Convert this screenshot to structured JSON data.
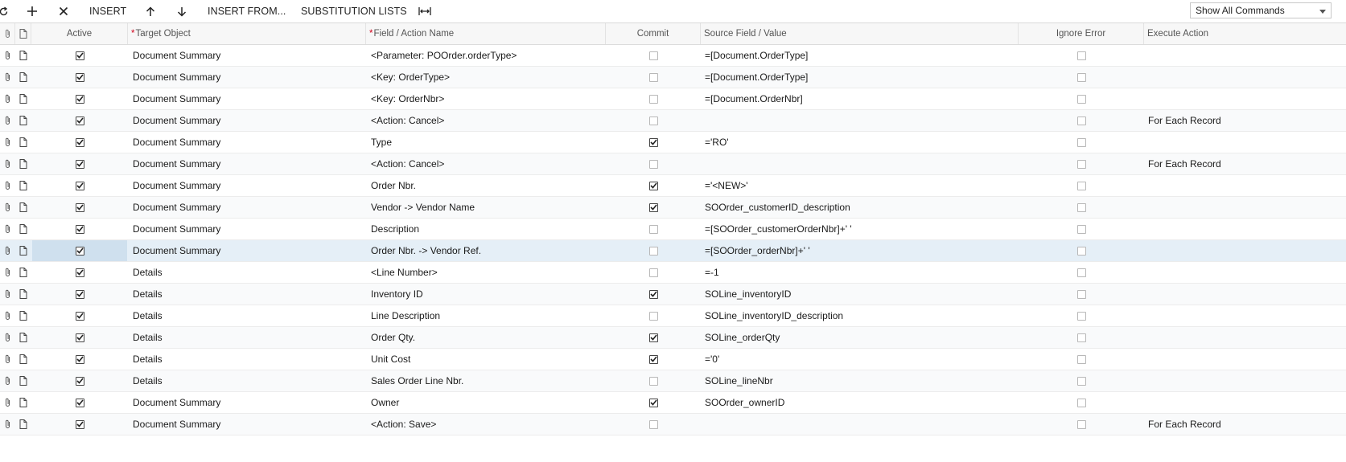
{
  "toolbar": {
    "insert_label": "INSERT",
    "insert_from_label": "INSERT FROM...",
    "substitution_lists_label": "SUBSTITUTION LISTS",
    "command_filter": "Show All Commands"
  },
  "columns": {
    "active": "Active",
    "target_object": "Target Object",
    "field_action": "Field / Action Name",
    "commit": "Commit",
    "source_value": "Source Field / Value",
    "ignore_error": "Ignore Error",
    "execute_action": "Execute Action"
  },
  "rows": [
    {
      "active": true,
      "target": "Document Summary",
      "field": "<Parameter: POOrder.orderType>",
      "commit": false,
      "source": "=[Document.OrderType]",
      "ignore": false,
      "execute": ""
    },
    {
      "active": true,
      "target": "Document Summary",
      "field": "<Key: OrderType>",
      "commit": false,
      "source": "=[Document.OrderType]",
      "ignore": false,
      "execute": ""
    },
    {
      "active": true,
      "target": "Document Summary",
      "field": "<Key: OrderNbr>",
      "commit": false,
      "source": "=[Document.OrderNbr]",
      "ignore": false,
      "execute": ""
    },
    {
      "active": true,
      "target": "Document Summary",
      "field": "<Action: Cancel>",
      "commit": false,
      "source": "",
      "ignore": false,
      "execute": "For Each Record"
    },
    {
      "active": true,
      "target": "Document Summary",
      "field": "Type",
      "commit": true,
      "source": "='RO'",
      "ignore": false,
      "execute": ""
    },
    {
      "active": true,
      "target": "Document Summary",
      "field": "<Action: Cancel>",
      "commit": false,
      "source": "",
      "ignore": false,
      "execute": "For Each Record"
    },
    {
      "active": true,
      "target": "Document Summary",
      "field": "Order Nbr.",
      "commit": true,
      "source": "='<NEW>'",
      "ignore": false,
      "execute": ""
    },
    {
      "active": true,
      "target": "Document Summary",
      "field": "Vendor -> Vendor Name",
      "commit": true,
      "source": "SOOrder_customerID_description",
      "ignore": false,
      "execute": ""
    },
    {
      "active": true,
      "target": "Document Summary",
      "field": "Description",
      "commit": false,
      "source": "=[SOOrder_customerOrderNbr]+' '",
      "ignore": false,
      "execute": ""
    },
    {
      "active": true,
      "target": "Document Summary",
      "field": "Order Nbr. -> Vendor Ref.",
      "commit": false,
      "source": "=[SOOrder_orderNbr]+' '",
      "ignore": false,
      "execute": "",
      "selected": true
    },
    {
      "active": true,
      "target": "Details",
      "field": "<Line Number>",
      "commit": false,
      "source": "=-1",
      "ignore": false,
      "execute": ""
    },
    {
      "active": true,
      "target": "Details",
      "field": "Inventory ID",
      "commit": true,
      "source": "SOLine_inventoryID",
      "ignore": false,
      "execute": ""
    },
    {
      "active": true,
      "target": "Details",
      "field": "Line Description",
      "commit": false,
      "source": "SOLine_inventoryID_description",
      "ignore": false,
      "execute": ""
    },
    {
      "active": true,
      "target": "Details",
      "field": "Order Qty.",
      "commit": true,
      "source": "SOLine_orderQty",
      "ignore": false,
      "execute": ""
    },
    {
      "active": true,
      "target": "Details",
      "field": "Unit Cost",
      "commit": true,
      "source": "='0'",
      "ignore": false,
      "execute": ""
    },
    {
      "active": true,
      "target": "Details",
      "field": "Sales Order Line Nbr.",
      "commit": false,
      "source": "SOLine_lineNbr",
      "ignore": false,
      "execute": ""
    },
    {
      "active": true,
      "target": "Document Summary",
      "field": "Owner",
      "commit": true,
      "source": "SOOrder_ownerID",
      "ignore": false,
      "execute": ""
    },
    {
      "active": true,
      "target": "Document Summary",
      "field": "<Action: Save>",
      "commit": false,
      "source": "",
      "ignore": false,
      "execute": "For Each Record"
    }
  ]
}
